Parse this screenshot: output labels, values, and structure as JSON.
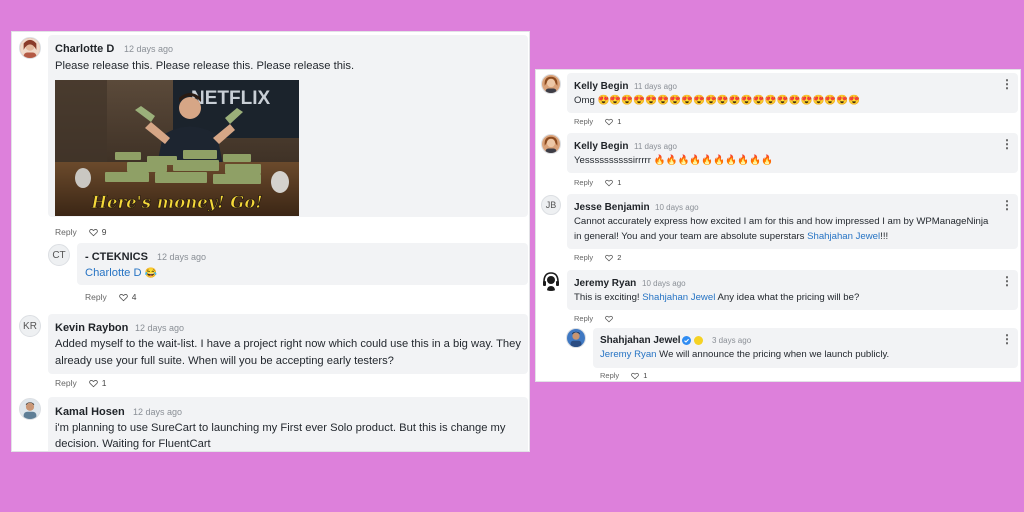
{
  "left": {
    "comments": [
      {
        "author": "Charlotte D",
        "time": "12 days ago",
        "text": "Please release this. Please release this. Please release this.",
        "gif_caption": "Here's money! Go!",
        "gif_sign": "NETFLIX",
        "reply_label": "Reply",
        "likes": "9"
      },
      {
        "author": "- CTEKNICS",
        "initials": "CT",
        "time": "12 days ago",
        "mention": "Charlotte D",
        "emoji": "😂",
        "reply_label": "Reply",
        "likes": "4"
      },
      {
        "author": "Kevin Raybon",
        "initials": "KR",
        "time": "12 days ago",
        "line1": "Added myself to the wait-list. I have a project right now which could use this in a big way. They",
        "line2": "already use your full suite. When will you be accepting early testers?",
        "reply_label": "Reply",
        "likes": "1"
      },
      {
        "author": "Kamal Hosen",
        "time": "12 days ago",
        "line1": "i'm planning to use SureCart to launching my First ever Solo product. But this is change my",
        "line2": "decision. Waiting for FluentCart"
      }
    ]
  },
  "right": {
    "comments": [
      {
        "author": "Kelly Begin",
        "time": "11 days ago",
        "text": "Omg 😍😍😍😍😍😍😍😍😍😍😍😍😍😍😍😍😍😍😍😍😍😍",
        "reply_label": "Reply",
        "likes": "1"
      },
      {
        "author": "Kelly Begin",
        "time": "11 days ago",
        "text": "Yessssssssssirrrrr 🔥🔥🔥🔥🔥🔥🔥🔥🔥🔥",
        "reply_label": "Reply",
        "likes": "1"
      },
      {
        "author": "Jesse Benjamin",
        "initials": "JB",
        "time": "10 days ago",
        "line1": "Cannot accurately express how excited I am for this and how impressed I am by WPManageNinja",
        "line2_pre": "in general! You and your team are absolute superstars ",
        "mention": "Shahjahan Jewel",
        "line2_post": "!!!",
        "reply_label": "Reply",
        "likes": "2"
      },
      {
        "author": "Jeremy Ryan",
        "time": "10 days ago",
        "text_pre": "This is exciting! ",
        "mention": "Shahjahan Jewel",
        "text_post": " Any idea what the pricing will be?",
        "reply_label": "Reply",
        "likes": ""
      },
      {
        "author": "Shahjahan Jewel",
        "time": "3 days ago",
        "mention": "Jeremy Ryan",
        "text_post": " We will announce the pricing when we launch publicly.",
        "reply_label": "Reply",
        "likes": "1"
      }
    ]
  },
  "colors": {
    "background": "#dd80db",
    "mention": "#2774c4",
    "bubble": "#f2f3f5"
  },
  "icons": [
    "heart-icon",
    "more-options-icon",
    "verified-badge-icon",
    "status-dot-icon",
    "headset-avatar-icon"
  ]
}
